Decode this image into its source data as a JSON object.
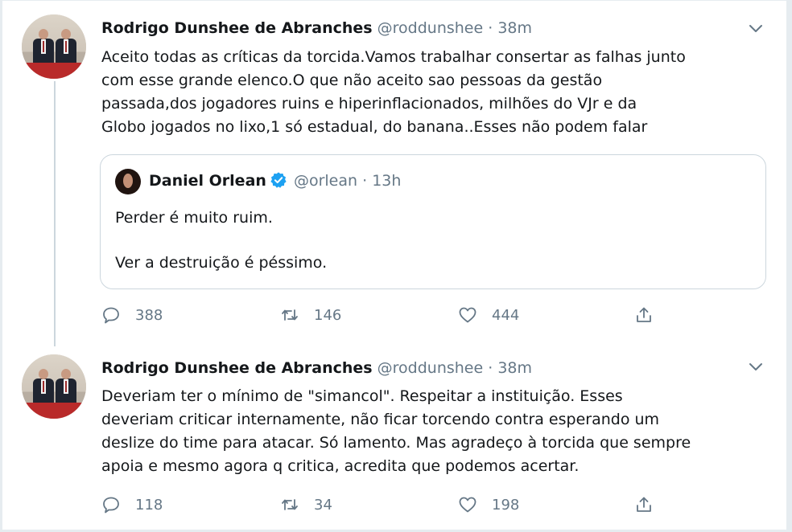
{
  "tweets": [
    {
      "author_name": "Rodrigo Dunshee de Abranches",
      "handle": "@roddunshee",
      "separator": "·",
      "time": "38m",
      "text": "Aceito todas as críticas da torcida.Vamos trabalhar consertar as falhas junto\ncom esse grande elenco.O que não aceito sao pessoas da gestão\npassada,dos jogadores ruins e  hiperinflacionados, milhões do VJr e da\nGlobo jogados no lixo,1 só estadual, do banana..Esses não podem falar",
      "quote": {
        "author_name": "Daniel Orlean",
        "handle": "@orlean",
        "separator": "·",
        "time": "13h",
        "line1": "Perder é muito ruim.",
        "line2": "Ver a destruição é péssimo."
      },
      "replies": "388",
      "retweets": "146",
      "likes": "444"
    },
    {
      "author_name": "Rodrigo Dunshee de Abranches",
      "handle": "@roddunshee",
      "separator": "·",
      "time": "38m",
      "text": "Deveriam ter o mínimo de \"simancol\". Respeitar a instituição.  Esses\ndeveriam criticar internamente, não ficar torcendo contra esperando um\ndeslize do time para atacar. Só lamento. Mas agradeço à torcida que sempre\napoia e mesmo agora q critica, acredita que podemos acertar.",
      "replies": "118",
      "retweets": "34",
      "likes": "198"
    }
  ],
  "icons": {
    "reply": "reply-icon",
    "retweet": "retweet-icon",
    "like": "heart-icon",
    "share": "share-icon",
    "more": "chevron-down-icon",
    "verified": "verified-badge-icon"
  },
  "colors": {
    "secondary_text": "#657786",
    "verified_blue": "#1da1f2",
    "border": "#ccd6dd"
  }
}
